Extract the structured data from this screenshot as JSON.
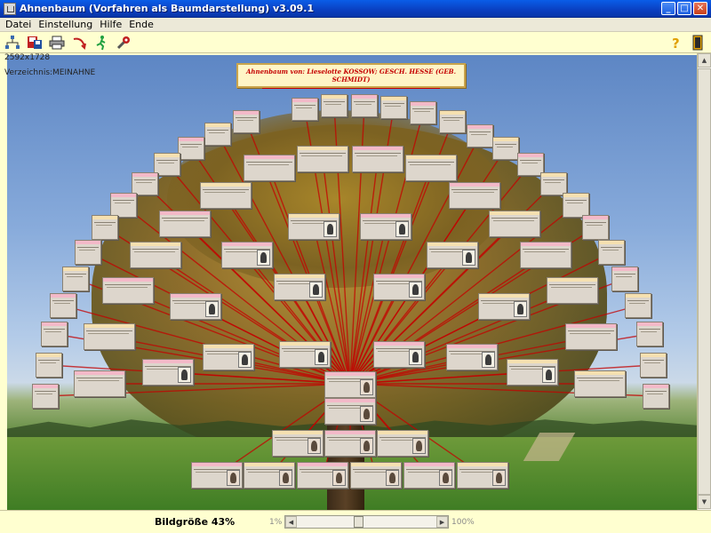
{
  "window": {
    "title": "Ahnenbaum (Vorfahren als Baumdarstellung) v3.09.1",
    "minimize_icon": "minimize-icon",
    "maximize_icon": "maximize-icon",
    "close_icon": "close-icon"
  },
  "menu": {
    "items": [
      "Datei",
      "Einstellung",
      "Hilfe",
      "Ende"
    ]
  },
  "toolbar": {
    "tools": [
      "tree-icon",
      "save-icon",
      "print-icon",
      "undo-icon",
      "run-icon",
      "tools-icon"
    ],
    "help_icon": "help-icon",
    "exit_icon": "exit-door-icon"
  },
  "main": {
    "size_text": "2592x1728",
    "dir_text": "Verzeichnis:MEINAHNE",
    "header_title": "Ahnenbaum von: Lieselotte KOSSOW; GESCH. HESSE (GEB. SCHMIDT)"
  },
  "status": {
    "label": "Bildgröße 43%",
    "zoom_min": "1%",
    "zoom_max": "100%",
    "zoom_level": 0.43
  },
  "colors": {
    "title_bar": "#0a3fc0",
    "toolbar_bg": "#ffffd0",
    "node_female_header": "#f3b9c8",
    "node_male_header": "#f5e0b0",
    "connector": "#c40000"
  }
}
